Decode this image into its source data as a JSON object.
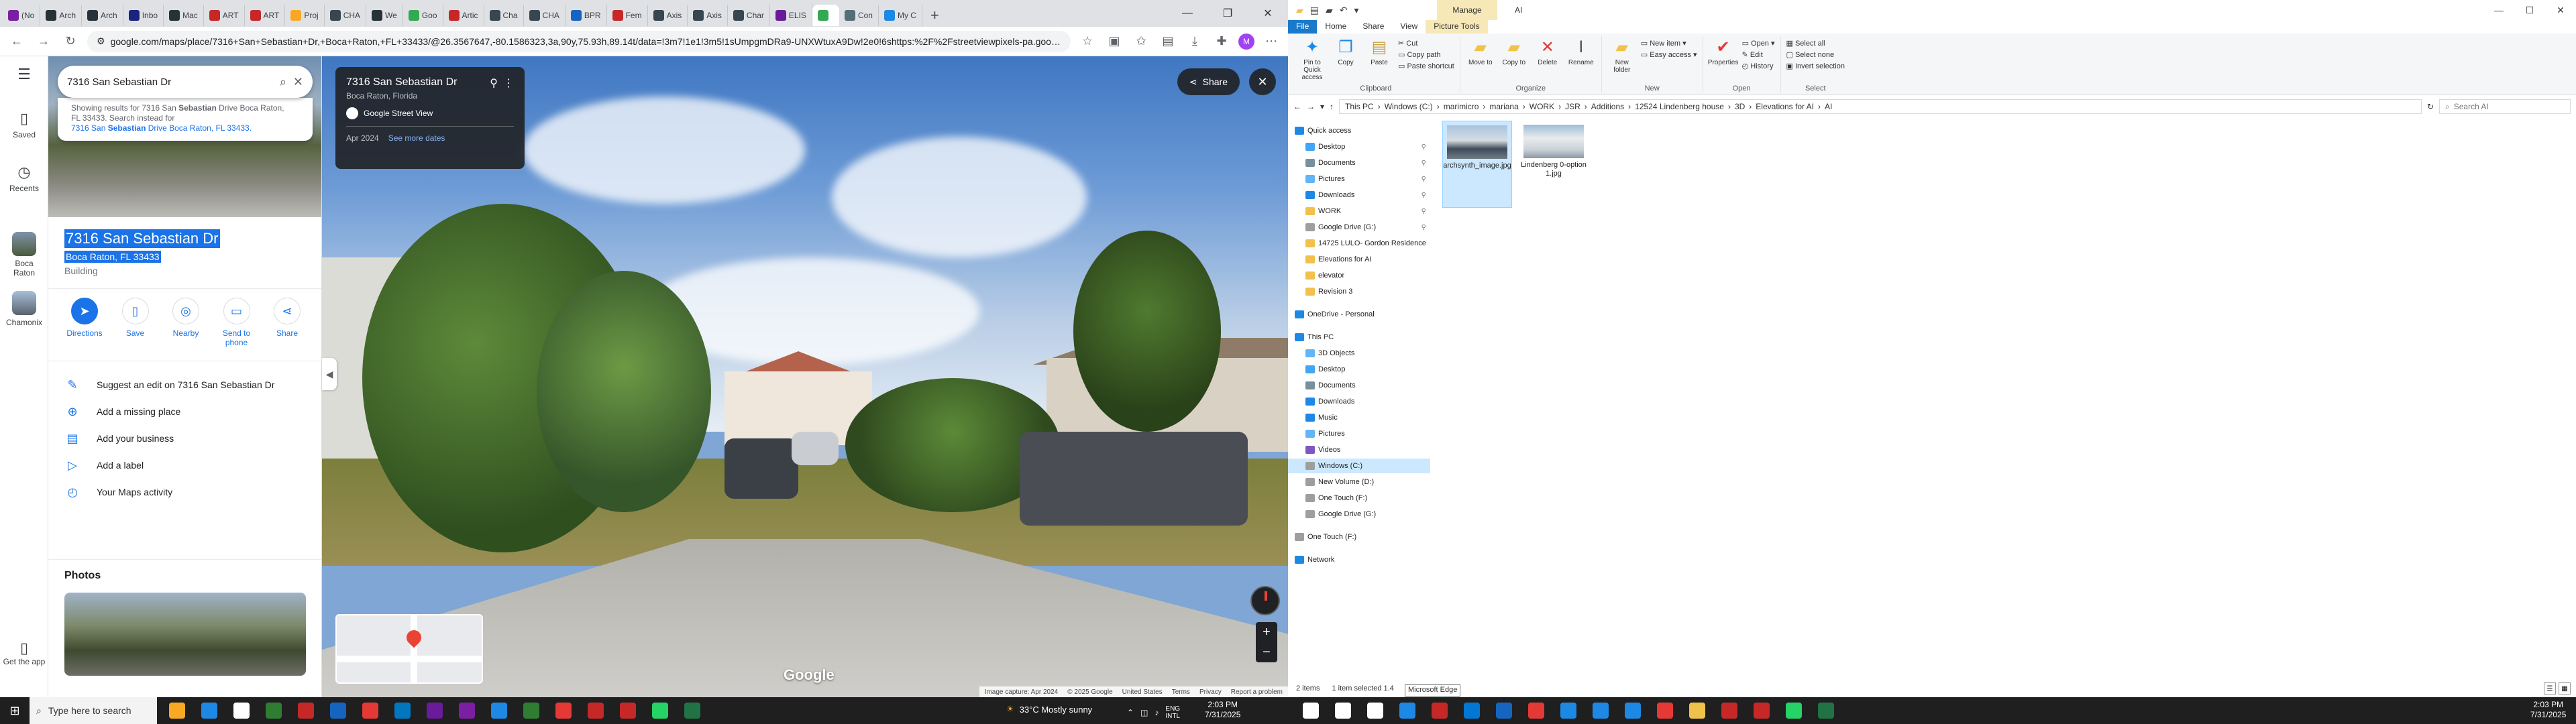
{
  "browser": {
    "tabs": [
      {
        "label": "(No",
        "color": "#7b1fa2"
      },
      {
        "label": "Arch",
        "color": "#263238"
      },
      {
        "label": "Arch",
        "color": "#263238"
      },
      {
        "label": "Inbo",
        "color": "#1a237e"
      },
      {
        "label": "Mac",
        "color": "#263238"
      },
      {
        "label": "ART",
        "color": "#c62828"
      },
      {
        "label": "ART",
        "color": "#c62828"
      },
      {
        "label": "Proj",
        "color": "#f9a825"
      },
      {
        "label": "CHA",
        "color": "#37474f"
      },
      {
        "label": "We",
        "color": "#263238"
      },
      {
        "label": "Goo",
        "color": "#34a853"
      },
      {
        "label": "Artic",
        "color": "#c62828"
      },
      {
        "label": "Cha",
        "color": "#37474f"
      },
      {
        "label": "CHA",
        "color": "#37474f"
      },
      {
        "label": "BPR",
        "color": "#1565c0"
      },
      {
        "label": "Fem",
        "color": "#c62828"
      },
      {
        "label": "Axis",
        "color": "#37474f"
      },
      {
        "label": "Axis",
        "color": "#37474f"
      },
      {
        "label": "Char",
        "color": "#37474f"
      },
      {
        "label": "ELIS",
        "color": "#6a1b9a"
      },
      {
        "label": "",
        "color": "#34a853",
        "active": true
      },
      {
        "label": "Con",
        "color": "#546e7a"
      },
      {
        "label": "My C",
        "color": "#1e88e5"
      }
    ],
    "new_tab": "+",
    "url": "google.com/maps/place/7316+San+Sebastian+Dr,+Boca+Raton,+FL+33433/@26.3567647,-80.1586323,3a,90y,75.93h,89.14t/data=!3m7!1e1!3m5!1sUmpgmDRa9-UNXWtuxA9Dw!2e0!6shttps:%2F%2Fstreetviewpixels-pa.googleapis.co...",
    "profile_initial": "M",
    "maps": {
      "rail": {
        "saved": "Saved",
        "recents": "Recents",
        "boca": "Boca Raton",
        "chamonix": "Chamonix",
        "get_app": "Get the app"
      },
      "search_query": "7316 San Sebastian Dr",
      "suggest": {
        "line1": "Showing results for 7316 San ",
        "line1_bold": "Sebastian",
        "line1_rest": " Drive Boca Raton,",
        "line2": "FL 33433. Search instead for",
        "line3_a": "7316 San ",
        "line3_b": "Sebastian",
        "line3_c": " Drive Boca Raton, FL 33433."
      },
      "place_title": "7316 San Sebastian Dr",
      "place_subtitle": "Boca Raton, FL 33433",
      "place_type": "Building",
      "actions": [
        {
          "label": "Directions",
          "icon": "directions-icon",
          "glyph": "➤"
        },
        {
          "label": "Save",
          "icon": "bookmark-icon",
          "glyph": "▯"
        },
        {
          "label": "Nearby",
          "icon": "nearby-icon",
          "glyph": "◎"
        },
        {
          "label": "Send to phone",
          "icon": "phone-icon",
          "glyph": "▭"
        },
        {
          "label": "Share",
          "icon": "share-icon",
          "glyph": "⋖"
        }
      ],
      "list": [
        {
          "label": "Suggest an edit on 7316 San Sebastian Dr",
          "icon": "pencil-icon",
          "glyph": "✎"
        },
        {
          "label": "Add a missing place",
          "icon": "add-place-icon",
          "glyph": "⊕"
        },
        {
          "label": "Add your business",
          "icon": "store-icon",
          "glyph": "▤"
        },
        {
          "label": "Add a label",
          "icon": "label-icon",
          "glyph": "▷"
        },
        {
          "label": "Your Maps activity",
          "icon": "history-icon",
          "glyph": "◴"
        }
      ],
      "photos_heading": "Photos",
      "streetview": {
        "title": "7316 San Sebastian Dr",
        "city": "Boca Raton, Florida",
        "provider": "Google Street View",
        "date": "Apr 2024",
        "more_dates": "See more dates",
        "share": "Share",
        "google": "Google",
        "attribution": [
          "Image capture: Apr 2024",
          "© 2025 Google",
          "United States",
          "Terms",
          "Privacy",
          "Report a problem"
        ]
      }
    }
  },
  "explorer": {
    "contextual_tab": "Manage",
    "tabs": [
      "File",
      "Home",
      "Share",
      "View",
      "Picture Tools"
    ],
    "title": "AI",
    "ribbon": {
      "clipboard": {
        "pin": "Pin to Quick access",
        "copy": "Copy",
        "paste": "Paste",
        "cut": "Cut",
        "copy_path": "Copy path",
        "paste_shortcut": "Paste shortcut",
        "label": "Clipboard"
      },
      "organize": {
        "move_to": "Move to",
        "copy_to": "Copy to",
        "delete": "Delete",
        "rename": "Rename",
        "label": "Organize"
      },
      "new": {
        "new_folder": "New folder",
        "new_item": "New item",
        "easy_access": "Easy access",
        "label": "New"
      },
      "open": {
        "properties": "Properties",
        "open": "Open",
        "edit": "Edit",
        "history": "History",
        "label": "Open"
      },
      "select": {
        "select_all": "Select all",
        "select_none": "Select none",
        "invert": "Invert selection",
        "label": "Select"
      }
    },
    "breadcrumb": [
      "This PC",
      "Windows (C:)",
      "marimicro",
      "mariana",
      "WORK",
      "JSR",
      "Additions",
      "12524 Lindenberg house",
      "3D",
      "Elevations for AI",
      "AI"
    ],
    "search_placeholder": "Search AI",
    "nav": [
      {
        "label": "Quick access",
        "indent": 0,
        "color": "#1e88e5",
        "pin": false
      },
      {
        "label": "Desktop",
        "indent": 1,
        "color": "#42a5f5",
        "pin": true
      },
      {
        "label": "Documents",
        "indent": 1,
        "color": "#78909c",
        "pin": true
      },
      {
        "label": "Pictures",
        "indent": 1,
        "color": "#64b5f6",
        "pin": true
      },
      {
        "label": "Downloads",
        "indent": 1,
        "color": "#1e88e5",
        "pin": true
      },
      {
        "label": "WORK",
        "indent": 1,
        "color": "#f0c24b",
        "pin": true
      },
      {
        "label": "Google Drive (G:)",
        "indent": 1,
        "color": "#9e9e9e",
        "pin": true
      },
      {
        "label": "14725 LULO- Gordon Residence",
        "indent": 1,
        "color": "#f0c24b",
        "pin": false
      },
      {
        "label": "Elevations for AI",
        "indent": 1,
        "color": "#f0c24b",
        "pin": false
      },
      {
        "label": "elevator",
        "indent": 1,
        "color": "#f0c24b",
        "pin": false
      },
      {
        "label": "Revision 3",
        "indent": 1,
        "color": "#f0c24b",
        "pin": false
      },
      {
        "label": "OneDrive - Personal",
        "indent": 0,
        "color": "#1e88e5",
        "pin": false
      },
      {
        "label": "This PC",
        "indent": 0,
        "color": "#1e88e5",
        "pin": false
      },
      {
        "label": "3D Objects",
        "indent": 1,
        "color": "#64b5f6",
        "pin": false
      },
      {
        "label": "Desktop",
        "indent": 1,
        "color": "#42a5f5",
        "pin": false
      },
      {
        "label": "Documents",
        "indent": 1,
        "color": "#78909c",
        "pin": false
      },
      {
        "label": "Downloads",
        "indent": 1,
        "color": "#1e88e5",
        "pin": false
      },
      {
        "label": "Music",
        "indent": 1,
        "color": "#1e88e5",
        "pin": false
      },
      {
        "label": "Pictures",
        "indent": 1,
        "color": "#64b5f6",
        "pin": false
      },
      {
        "label": "Videos",
        "indent": 1,
        "color": "#7e57c2",
        "pin": false
      },
      {
        "label": "Windows (C:)",
        "indent": 1,
        "color": "#9e9e9e",
        "pin": false,
        "selected": true
      },
      {
        "label": "New Volume (D:)",
        "indent": 1,
        "color": "#9e9e9e",
        "pin": false
      },
      {
        "label": "One Touch (F:)",
        "indent": 1,
        "color": "#9e9e9e",
        "pin": false
      },
      {
        "label": "Google Drive (G:)",
        "indent": 1,
        "color": "#9e9e9e",
        "pin": false
      },
      {
        "label": "One Touch (F:)",
        "indent": 0,
        "color": "#9e9e9e",
        "pin": false
      },
      {
        "label": "Network",
        "indent": 0,
        "color": "#1e88e5",
        "pin": false
      }
    ],
    "files": [
      {
        "name": "archsynth_image.jpg",
        "selected": true
      },
      {
        "name": "Lindenberg 0-option 1.jpg",
        "selected": false
      }
    ],
    "status": {
      "items": "2 items",
      "selected": "1 item selected  1.4",
      "tooltip": "Microsoft Edge"
    }
  },
  "taskbar": {
    "search_placeholder": "Type here to search",
    "weather": "33°C  Mostly sunny",
    "lang": "ENG",
    "region": "INTL",
    "time": "2:03 PM",
    "date": "7/31/2025",
    "time2": "2:03 PM",
    "date2": "7/31/2025"
  }
}
